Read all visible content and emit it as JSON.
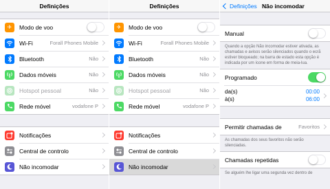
{
  "screen1": {
    "title": "Definições",
    "items": [
      {
        "label": "Modo de voo",
        "value": "",
        "icon": "airplane-icon"
      },
      {
        "label": "Wi-Fi",
        "value": "Forall Phones Mobile",
        "icon": "wifi-icon"
      },
      {
        "label": "Bluetooth",
        "value": "Não",
        "icon": "bluetooth-icon"
      },
      {
        "label": "Dados móveis",
        "value": "Não",
        "icon": "cellular-icon"
      },
      {
        "label": "Hotspot pessoal",
        "value": "Não",
        "icon": "hotspot-icon"
      },
      {
        "label": "Rede móvel",
        "value": "vodafone P",
        "icon": "phone-icon"
      }
    ],
    "items2": [
      {
        "label": "Notificações",
        "icon": "notifications-icon"
      },
      {
        "label": "Central de controlo",
        "icon": "control-center-icon"
      },
      {
        "label": "Não incomodar",
        "icon": "moon-icon"
      }
    ]
  },
  "screen2": {
    "title": "Definições",
    "items": [
      {
        "label": "Modo de voo",
        "value": ""
      },
      {
        "label": "Wi-Fi",
        "value": "Forall Phones Mobile"
      },
      {
        "label": "Bluetooth",
        "value": "Não"
      },
      {
        "label": "Dados móveis",
        "value": "Não"
      },
      {
        "label": "Hotspot pessoal",
        "value": "Não"
      },
      {
        "label": "Rede móvel",
        "value": "vodafone P"
      }
    ],
    "items2": [
      {
        "label": "Notificações"
      },
      {
        "label": "Central de controlo"
      },
      {
        "label": "Não incomodar"
      }
    ]
  },
  "screen3": {
    "back_label": "Definições",
    "title": "Não incomodar",
    "manual_label": "Manual",
    "manual_note": "Quando a opção Não incomodar estiver ativada, as chamadas e avisos serão silenciados quando o ecrã estiver bloqueado; na barra de estado esta opção é indicada por um ícone em forma de meia-lua.",
    "scheduled_label": "Programado",
    "from_label": "da(s)",
    "to_label": "à(s)",
    "from_time": "00:00",
    "to_time": "06:00",
    "allow_calls_label": "Permitir chamadas de",
    "allow_calls_value": "Favoritos",
    "allow_calls_note": "As chamadas dos seus favoritos não serão silenciadas.",
    "repeated_calls_label": "Chamadas repetidas",
    "repeated_calls_note": "Se alguém lhe ligar uma segunda vez dentro de"
  },
  "colors": {
    "accent": "#007aff",
    "toggle_on": "#4cd964",
    "airplane": "#ff9500",
    "notifications": "#ff3b30",
    "moon": "#5856d6"
  }
}
